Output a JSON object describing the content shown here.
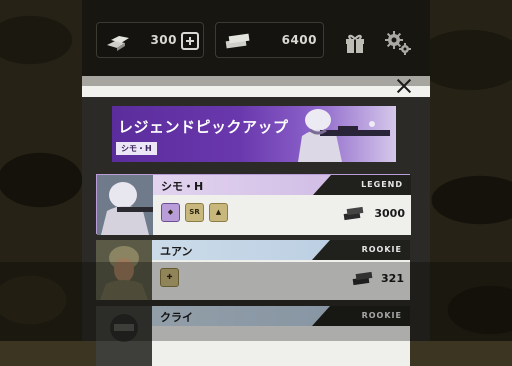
{
  "resources": {
    "gold": {
      "value": "300",
      "icon": "gold-bars-icon"
    },
    "cash": {
      "value": "6400",
      "icon": "cash-stack-icon"
    }
  },
  "header_icons": [
    "gift-icon",
    "settings-gear-icon"
  ],
  "close_icon": "close-icon",
  "banner": {
    "title": "レジェンドピックアップ",
    "tag": "シモ・H"
  },
  "characters": [
    {
      "name": "シモ・H",
      "rank": "LEGEND",
      "price": "3000",
      "badges": [
        "◆",
        "SR",
        "▲"
      ],
      "accent": "#b99dd8"
    },
    {
      "name": "ユアン",
      "rank": "ROOKIE",
      "price": "321",
      "badges": [
        "✚"
      ],
      "accent": "#b6cbe0"
    },
    {
      "name": "クライ",
      "rank": "ROOKIE",
      "price": "",
      "badges": [],
      "accent": "#b6cbe0"
    }
  ]
}
